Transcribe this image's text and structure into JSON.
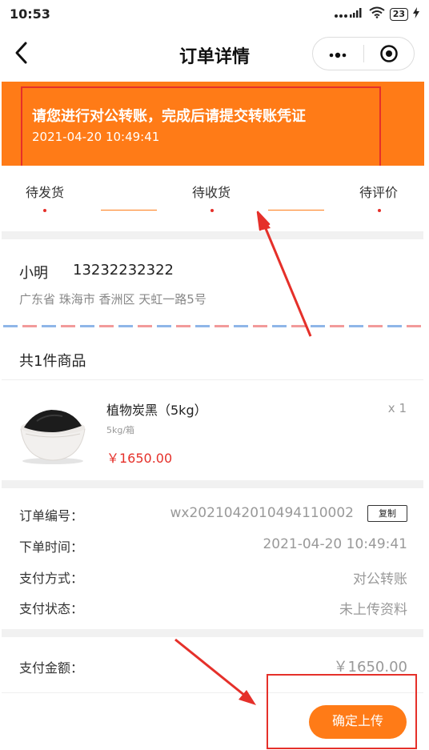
{
  "status_bar": {
    "time": "10:53",
    "signal_text": "... .ıl",
    "battery": "23"
  },
  "nav": {
    "title": "订单详情",
    "more_icon": "more-dots-icon",
    "capsule_icon": "target-circle-icon"
  },
  "banner": {
    "title": "请您进行对公转账，完成后请提交转账凭证",
    "time": "2021-04-20   10:49:41",
    "bg_color": "#ff7b17"
  },
  "steps": [
    {
      "label": "待发货"
    },
    {
      "label": "待收货"
    },
    {
      "label": "待评价"
    }
  ],
  "address": {
    "name": "小明",
    "phone": "13232232322",
    "detail": "广东省 珠海市 香洲区 天虹一路5号"
  },
  "goods": {
    "header": "共1件商品",
    "items": [
      {
        "name": "植物炭黑（5kg）",
        "spec": "5kg/箱",
        "price": "￥1650.00",
        "qty": "x 1",
        "image_icon": "charcoal-bowl-image"
      }
    ]
  },
  "order_info": {
    "order_no_label": "订单编号：",
    "order_no": "wx2021042010494110002",
    "copy_label": "复制",
    "time_label": "下单时间：",
    "time": "2021-04-20 10:49:41",
    "pay_method_label": "支付方式：",
    "pay_method": "对公转账",
    "pay_status_label": "支付状态：",
    "pay_status": "未上传资料"
  },
  "payment": {
    "amount_label": "支付金额：",
    "amount": "￥1650.00",
    "confirm_label": "确定上传"
  },
  "colors": {
    "accent": "#ff7b17",
    "annotation": "#e5302a",
    "price": "#e5302a"
  }
}
